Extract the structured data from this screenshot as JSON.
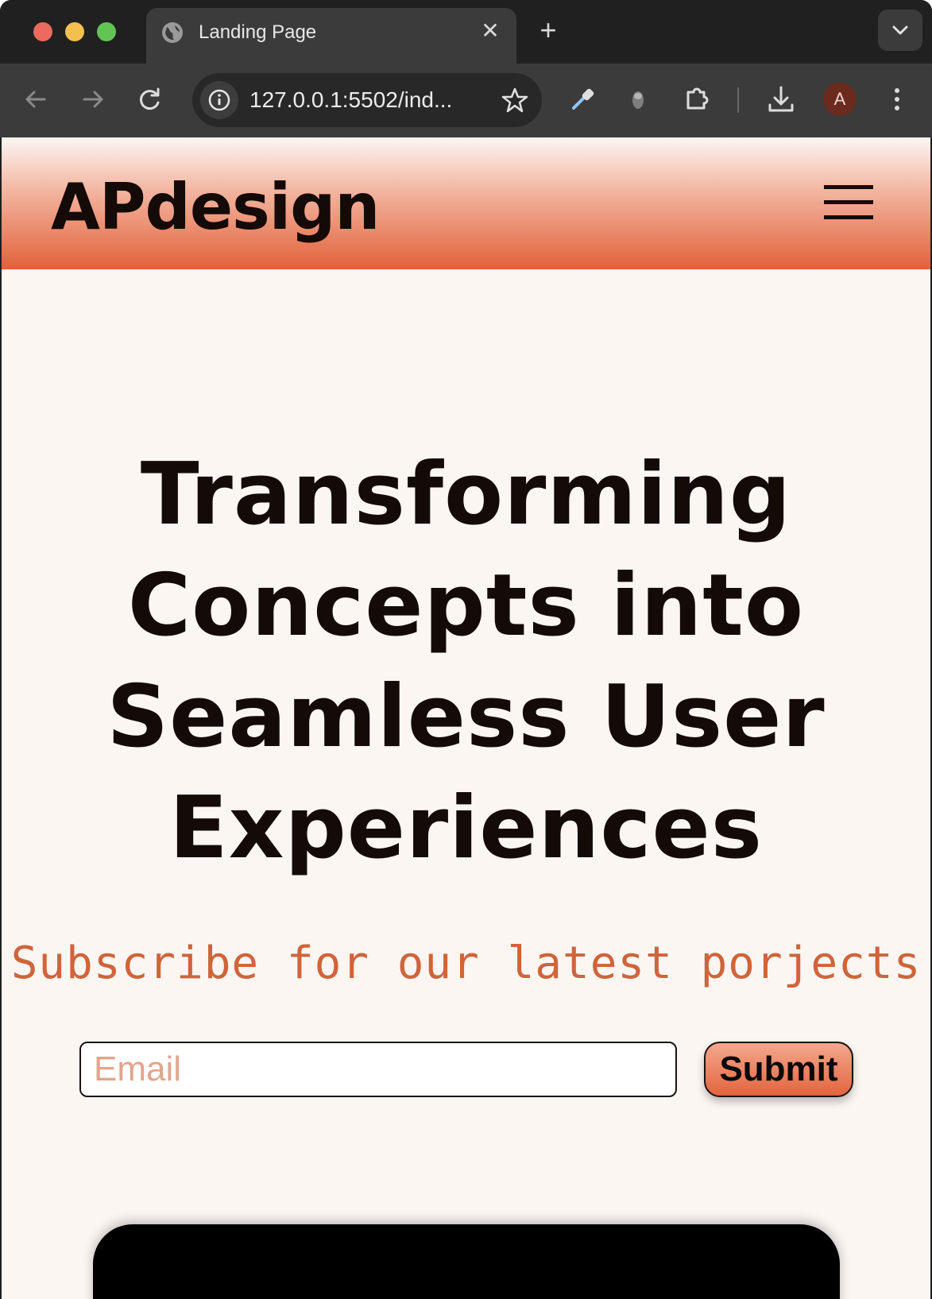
{
  "browser": {
    "tab_title": "Landing Page",
    "url": "127.0.0.1:5502/ind...",
    "profile_initial": "A"
  },
  "site": {
    "logo": "APdesign",
    "hero_lines": [
      "Transforming",
      "Concepts into",
      "Seamless User",
      "Experiences"
    ],
    "subscribe_text": "Subscribe for our latest porjects",
    "email_placeholder": "Email",
    "submit_label": "Submit"
  },
  "colors": {
    "accent": "#e2613a",
    "subscribe_text": "#d0643a",
    "page_background": "#fcf6f3",
    "text": "#140a08"
  },
  "icons": [
    "globe-icon",
    "close-icon",
    "plus-icon",
    "chevron-down-icon",
    "back-arrow-icon",
    "forward-arrow-icon",
    "reload-icon",
    "info-icon",
    "star-icon",
    "eyedropper-icon",
    "extension-puzzle-icon",
    "download-icon",
    "more-vert-icon",
    "hamburger-menu-icon"
  ]
}
